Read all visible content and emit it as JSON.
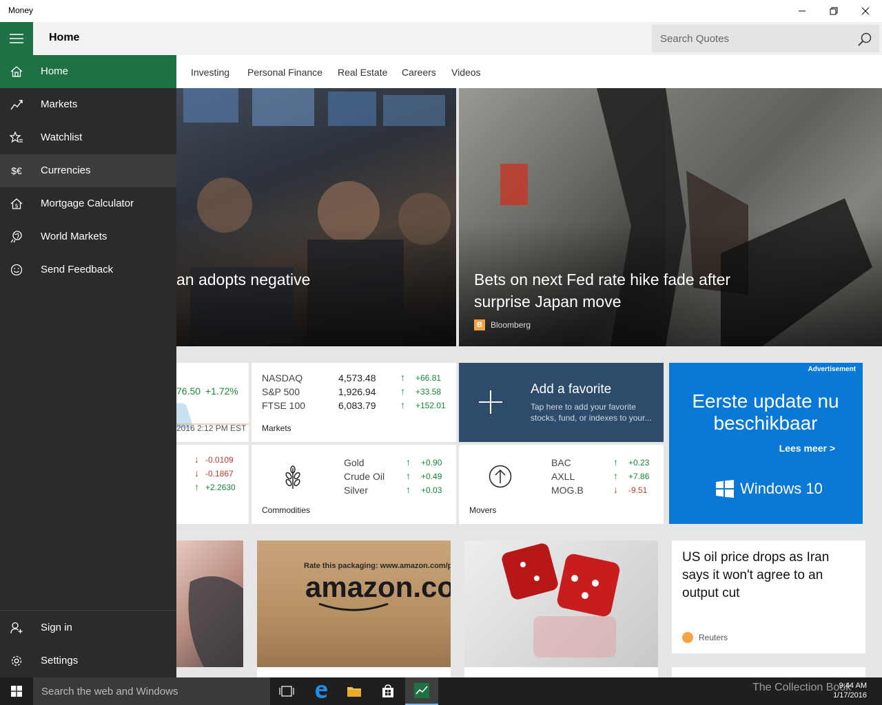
{
  "window": {
    "title": "Money"
  },
  "header": {
    "title": "Home",
    "search_placeholder": "Search Quotes"
  },
  "tabs": [
    "Investing",
    "Personal Finance",
    "Real Estate",
    "Careers",
    "Videos"
  ],
  "sidebar": {
    "items": [
      {
        "label": "Home",
        "icon": "home-icon"
      },
      {
        "label": "Markets",
        "icon": "chart-icon"
      },
      {
        "label": "Watchlist",
        "icon": "star-list-icon"
      },
      {
        "label": "Currencies",
        "icon": "currency-icon"
      },
      {
        "label": "Mortgage Calculator",
        "icon": "house-dollar-icon"
      },
      {
        "label": "World Markets",
        "icon": "globe-icon"
      },
      {
        "label": "Send Feedback",
        "icon": "smiley-icon"
      }
    ],
    "bottom": [
      {
        "label": "Sign in",
        "icon": "person-add-icon"
      },
      {
        "label": "Settings",
        "icon": "gear-icon"
      }
    ]
  },
  "hero": [
    {
      "title": "an adopts negative"
    },
    {
      "title": "Bets on next Fed rate hike fade after surprise Japan move",
      "source": "Bloomberg",
      "source_logo": "B"
    }
  ],
  "tiles": {
    "partial_quote": {
      "value": "76.50",
      "change": "+1.72%",
      "time": "2016 2:12 PM EST"
    },
    "currencies_partial": {
      "changes": [
        "-0.0109",
        "-0.1867",
        "+2.2630"
      ]
    },
    "markets": {
      "label": "Markets",
      "rows": [
        {
          "name": "NASDAQ",
          "value": "4,573.48",
          "change": "+66.81"
        },
        {
          "name": "S&P 500",
          "value": "1,926.94",
          "change": "+33.58"
        },
        {
          "name": "FTSE 100",
          "value": "6,083.79",
          "change": "+152.01"
        }
      ]
    },
    "favorite": {
      "title": "Add a favorite",
      "subtitle": "Tap here to add your favorite stocks, fund, or indexes to your..."
    },
    "commodities": {
      "label": "Commodities",
      "rows": [
        {
          "name": "Gold",
          "change": "+0.90"
        },
        {
          "name": "Crude Oil",
          "change": "+0.49"
        },
        {
          "name": "Silver",
          "change": "+0.03"
        }
      ]
    },
    "movers": {
      "label": "Movers",
      "rows": [
        {
          "name": "BAC",
          "change": "+0.23",
          "dir": "up"
        },
        {
          "name": "AXLL",
          "change": "+7.86",
          "dir": "up"
        },
        {
          "name": "MOG.B",
          "change": "-9.51",
          "dir": "down"
        }
      ]
    },
    "ad": {
      "tag": "Advertisement",
      "headline": "Eerste update nu beschikbaar",
      "cta": "Lees meer >",
      "brand": "Windows 10"
    }
  },
  "news": {
    "amazon_text_1": "Rate this packaging: www.amazon.com/pa",
    "amazon_text_2": "amazon.co",
    "card": {
      "title": "US oil price drops as Iran says it won't agree to an output cut",
      "source": "Reuters"
    }
  },
  "taskbar": {
    "search_placeholder": "Search the web and Windows",
    "time": "9:44 AM",
    "date": "1/17/2016",
    "watermark": "The Collection Book"
  },
  "colors": {
    "accent": "#1e7145",
    "sidebar": "#2b2b2b",
    "up": "#138a36",
    "down": "#c0392b",
    "ad": "#0a78d7",
    "favorite": "#2e4b6b"
  }
}
